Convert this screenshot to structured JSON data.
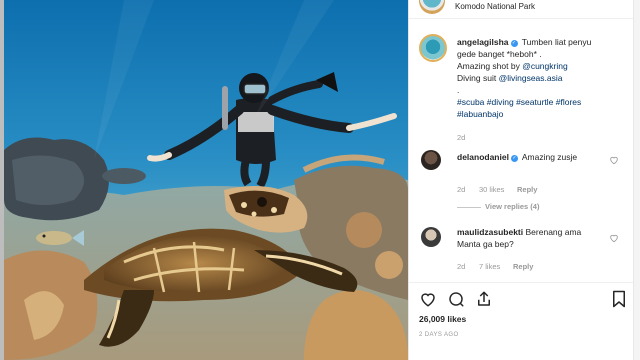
{
  "location": "Komodo National Park",
  "post": {
    "username": "angelagilsha",
    "caption_line1": "Tumben liat penyu",
    "caption_line2": "gede banget *heboh* .",
    "caption_line3_text": "Amazing shot by ",
    "caption_line3_mention": "@cungkring",
    "caption_line4_text": "Diving suit ",
    "caption_line4_mention": "@livingseas.asia",
    "caption_dot": ".",
    "hashtags_line1": "#scuba #diving #seaturtle #flores",
    "hashtags_line2": "#labuanbajo",
    "age": "2d"
  },
  "comments": [
    {
      "username": "delanodaniel",
      "text": "Amazing zusje",
      "age": "2d",
      "likes": "30 likes",
      "reply": "Reply",
      "view_replies": "View replies (4)"
    },
    {
      "username": "maulidzasubekti",
      "text_line1": "Berenang ama",
      "text_line2": "Manta ga bep?",
      "age": "2d",
      "likes": "7 likes",
      "reply": "Reply"
    }
  ],
  "actions": {
    "like_icon": "heart-icon",
    "comment_icon": "comment-icon",
    "share_icon": "share-icon",
    "save_icon": "bookmark-icon"
  },
  "likes_count": "26,009 likes",
  "posted_ago": "2 DAYS AGO",
  "colors": {
    "verified": "#3897f0",
    "mention_link": "#003569",
    "water_top": "#1f86bd",
    "water_bottom": "#5aa9c9"
  }
}
